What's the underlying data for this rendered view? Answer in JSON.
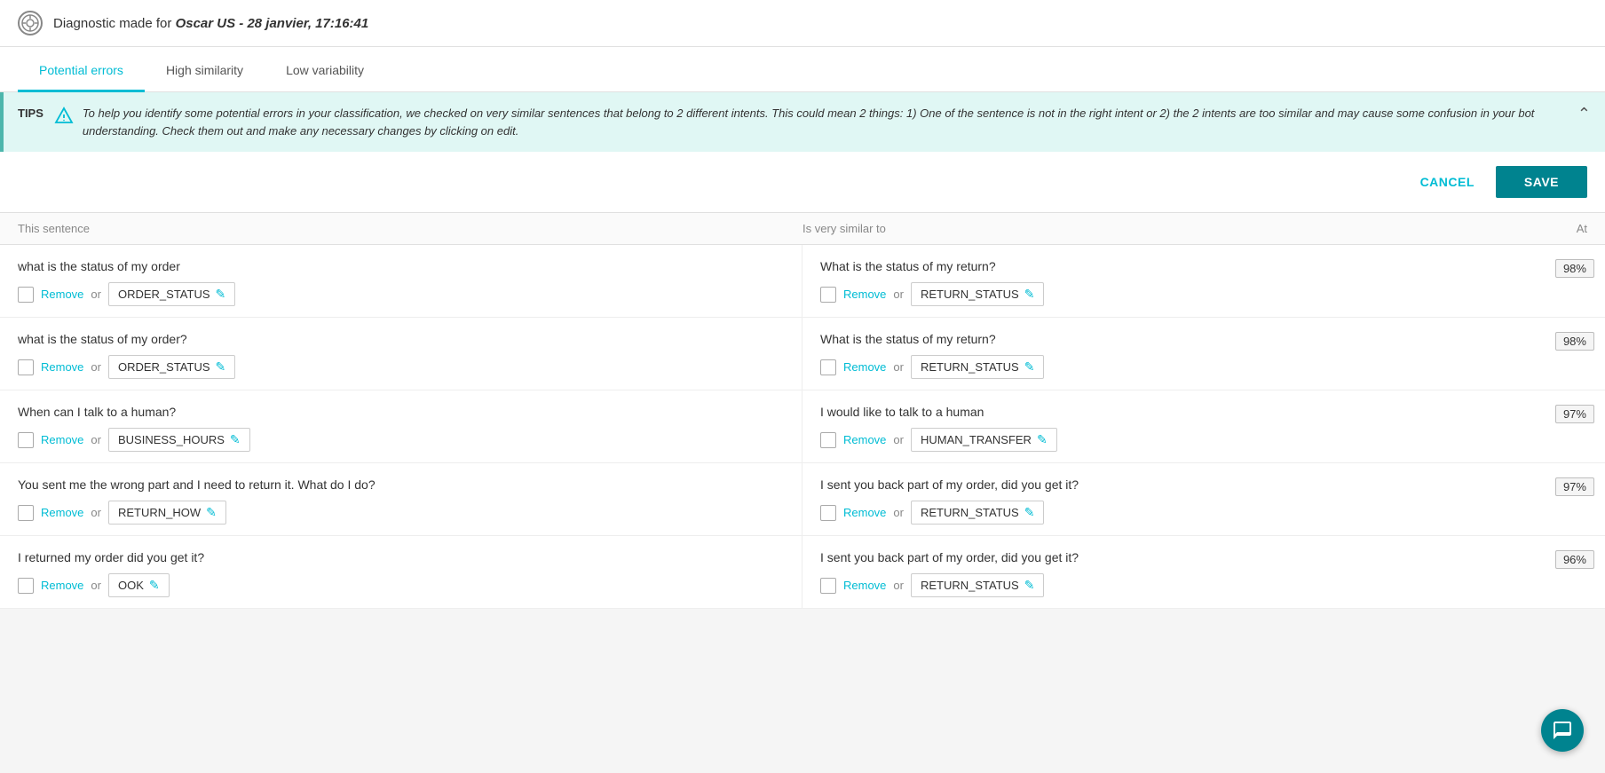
{
  "header": {
    "title_prefix": "Diagnostic made for ",
    "title_bold": "Oscar US - 28 janvier, 17:16:41"
  },
  "tabs": [
    {
      "id": "potential-errors",
      "label": "Potential errors",
      "active": true
    },
    {
      "id": "high-similarity",
      "label": "High similarity",
      "active": false
    },
    {
      "id": "low-variability",
      "label": "Low variability",
      "active": false
    }
  ],
  "tips": {
    "label": "TIPS",
    "text": "To help you identify some potential errors in your classification, we checked on very similar sentences that belong to 2 different intents. This could mean 2 things: 1) One of the sentence is not in the right intent or 2) the 2 intents are too similar and may cause some confusion in your bot understanding. Check them out and make any necessary changes by clicking on edit."
  },
  "toolbar": {
    "cancel_label": "CANCEL",
    "save_label": "SAVE"
  },
  "table": {
    "col_left": "This sentence",
    "col_right": "Is very similar to",
    "col_at": "At"
  },
  "rows": [
    {
      "left_sentence": "what is the status of my order",
      "left_intent": "ORDER_STATUS",
      "right_sentence": "What is the status of my return?",
      "right_intent": "RETURN_STATUS",
      "similarity": "98%"
    },
    {
      "left_sentence": "what is the status of my order?",
      "left_intent": "ORDER_STATUS",
      "right_sentence": "What is the status of my return?",
      "right_intent": "RETURN_STATUS",
      "similarity": "98%"
    },
    {
      "left_sentence": "When can I talk to a human?",
      "left_intent": "BUSINESS_HOURS",
      "right_sentence": "I would like to talk to a human",
      "right_intent": "HUMAN_TRANSFER",
      "similarity": "97%"
    },
    {
      "left_sentence": "You sent me the wrong part and I need to return it. What do I do?",
      "left_intent": "RETURN_HOW",
      "right_sentence": "I sent you back part of my order, did you get it?",
      "right_intent": "RETURN_STATUS",
      "similarity": "97%"
    },
    {
      "left_sentence": "I returned my order did you get it?",
      "left_intent": "OOK",
      "right_sentence": "I sent you back part of my order, did you get it?",
      "right_intent": "RETURN_STATUS",
      "similarity": "96%"
    }
  ],
  "remove_label": "Remove",
  "or_label": "or"
}
